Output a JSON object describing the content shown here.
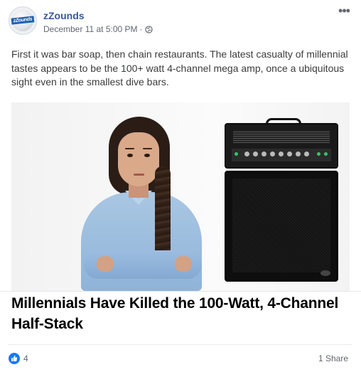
{
  "post": {
    "page_name": "zZounds",
    "avatar_logo_text": "zZounds",
    "timestamp": "December 11 at 5:00 PM",
    "separator": "·",
    "privacy_icon": "globe-icon",
    "more_icon": "more-options-icon",
    "body": "First it was bar soap, then chain restaurants. The latest casualty of millennial tastes appears to be the 100+ watt 4-channel mega amp, once a ubiquitous sight even in the smallest dive bars.",
    "link_headline": "Millennials Have Killed the 100-Watt, 4-Channel Half-Stack",
    "reactions": {
      "icon": "like-icon",
      "count": "4",
      "color": "#1877f2"
    },
    "shares": "1 Share"
  },
  "colors": {
    "page_name": "#385898",
    "meta_text": "#606770",
    "body_text": "#3a3b3c"
  }
}
